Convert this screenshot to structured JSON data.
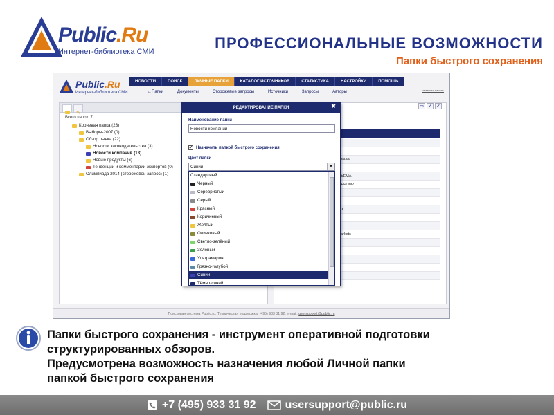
{
  "brand": {
    "logo_word_main": "Public",
    "logo_word_dot": ".Ru",
    "logo_subtitle": "Интернет-библиотека СМИ",
    "logo_tri_text": "Public.Ru"
  },
  "slide": {
    "title": "ПРОФЕССИОНАЛЬНЫЕ ВОЗМОЖНОСТИ",
    "subtitle": "Папки быстрого сохранения"
  },
  "app": {
    "top_nav": [
      "НОВОСТИ",
      "ПОИСК",
      "ЛИЧНЫЕ ПАПКИ",
      "КАТАЛОГ ИСТОЧНИКОВ",
      "СТАТИСТИКА",
      "НАСТРОЙКИ",
      "ПОМОЩЬ"
    ],
    "top_nav_active": "ЛИЧНЫЕ ПАПКИ",
    "sub_nav": [
      "Папки",
      "Документы",
      "Сторожевые запросы",
      "Источники",
      "Запросы",
      "Авторы"
    ],
    "change_password_link": "изменить пароль",
    "folders_count": "Всего папок: 7",
    "tree": [
      {
        "label": "Корневая папка (23)",
        "level": 0,
        "color": "#f0c640"
      },
      {
        "label": "Выборы-2007 (0)",
        "level": 1,
        "color": "#f0c640"
      },
      {
        "label": "Обзор рынка (22)",
        "level": 1,
        "color": "#f0c640"
      },
      {
        "label": "Новости законодательства (3)",
        "level": 2,
        "color": "#f0c640"
      },
      {
        "label": "Новости компаний (13)",
        "level": 2,
        "color": "#3a3fb4",
        "bold": true
      },
      {
        "label": "Новые продукты (6)",
        "level": 2,
        "color": "#f0c640"
      },
      {
        "label": "Тенденции и комментарии экспертов (0)",
        "level": 2,
        "color": "#d0443a"
      },
      {
        "label": "Олимпиада 2014 (сторожевой запрос) (1)",
        "level": 1,
        "color": "#f0c640"
      }
    ],
    "right_rows": [
      "",
      "",
      "компаний",
      "ю.",
      "О СЪЕМА.",
      "АРДЕРОМ?.",
      "",
      "",
      "ВСЕХ.",
      "",
      "",
      "al Markets",
      "ссия",
      "",
      "",
      "",
      ""
    ],
    "footer_text": "Поисковая система Public.ru. Техническая поддержка: (495) 933 31 92, e-mail:",
    "footer_email": "usersupport@public.ru"
  },
  "modal": {
    "title": "РЕДАКТИРОВАНИЕ ПАПКИ",
    "close_label": "✖",
    "name_label": "Наименование папки",
    "name_value": "Новости компаний",
    "checkbox_label": "Назначить папкой быстрого сохранения",
    "checkbox_mark": "✔",
    "color_label": "Цвет папки",
    "color_value": "Синий",
    "options": [
      {
        "label": "Стандартный",
        "color": ""
      },
      {
        "label": "Черный",
        "color": "#222222"
      },
      {
        "label": "Серебристый",
        "color": "#b8bcc6"
      },
      {
        "label": "Серый",
        "color": "#8a8a8a"
      },
      {
        "label": "Красный",
        "color": "#d0443a"
      },
      {
        "label": "Коричневый",
        "color": "#8a4a2a"
      },
      {
        "label": "Желтый",
        "color": "#f0c640"
      },
      {
        "label": "Оливковый",
        "color": "#8a8a3a"
      },
      {
        "label": "Светло-зелёный",
        "color": "#7ed66a"
      },
      {
        "label": "Зеленый",
        "color": "#3aa04a"
      },
      {
        "label": "Ультрамарин",
        "color": "#3a6ad6"
      },
      {
        "label": "Грязно-голубой",
        "color": "#5a8aa6"
      },
      {
        "label": "Синий",
        "color": "#3a3fb4",
        "selected": true
      },
      {
        "label": "Тёмно-синий",
        "color": "#1e2a6e"
      }
    ]
  },
  "info": {
    "lines": [
      "Папки быстрого сохранения - инструмент оперативной подготовки",
      "структурированных обзоров.",
      "Предусмотрена возможность назначения любой Личной папки",
      "папкой быстрого сохранения"
    ]
  },
  "contact": {
    "phone": "+7 (495) 933 31 92",
    "email": "usersupport@public.ru"
  }
}
